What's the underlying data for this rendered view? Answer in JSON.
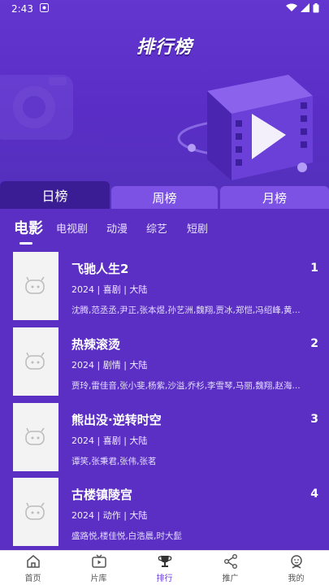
{
  "status": {
    "time": "2:43"
  },
  "hero": {
    "title": "排行榜"
  },
  "range_tabs": [
    {
      "label": "日榜",
      "active": true
    },
    {
      "label": "周榜",
      "active": false
    },
    {
      "label": "月榜",
      "active": false
    }
  ],
  "categories": [
    {
      "label": "电影",
      "active": true
    },
    {
      "label": "电视剧",
      "active": false
    },
    {
      "label": "动漫",
      "active": false
    },
    {
      "label": "综艺",
      "active": false
    },
    {
      "label": "短剧",
      "active": false
    }
  ],
  "items": [
    {
      "title": "飞驰人生2",
      "rank": "1",
      "meta": "2024 | 喜剧 | 大陆",
      "cast": "沈腾,范丞丞,尹正,张本煜,孙艺洲,魏翔,贾冰,郑恺,冯绍峰,黄..."
    },
    {
      "title": "热辣滚烫",
      "rank": "2",
      "meta": "2024 | 剧情 | 大陆",
      "cast": "贾玲,雷佳音,张小斐,杨紫,沙溢,乔杉,李雪琴,马丽,魏翔,赵海..."
    },
    {
      "title": "熊出没·逆转时空",
      "rank": "3",
      "meta": "2024 | 喜剧 | 大陆",
      "cast": "谭笑,张秉君,张伟,张茗"
    },
    {
      "title": "古楼镇陵宫",
      "rank": "4",
      "meta": "2024 | 动作 | 大陆",
      "cast": "盛路悦,楼佳悦,白浩晨,时大髭"
    }
  ],
  "bottom_nav": [
    {
      "label": "首页",
      "icon": "home-icon",
      "active": false
    },
    {
      "label": "片库",
      "icon": "tv-icon",
      "active": false
    },
    {
      "label": "排行",
      "icon": "trophy-icon",
      "active": true
    },
    {
      "label": "推广",
      "icon": "share-icon",
      "active": false
    },
    {
      "label": "我的",
      "icon": "profile-icon",
      "active": false
    }
  ],
  "colors": {
    "background": "#5b2fc4",
    "active_tab": "#3a1d94",
    "inactive_tab": "#7b52e3",
    "nav_active": "#6a3be0"
  }
}
